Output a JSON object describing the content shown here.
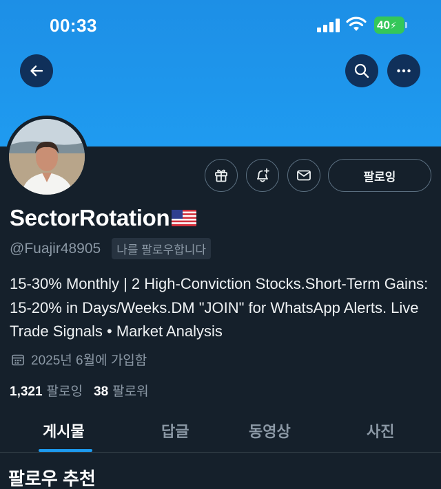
{
  "status_bar": {
    "time": "00:33",
    "battery": "40"
  },
  "profile": {
    "display_name": "SectorRotation",
    "handle": "@Fuajir48905",
    "follows_you": "나를 팔로우합니다",
    "bio": "15-30% Monthly | 2 High-Conviction Stocks.Short-Term Gains: 15-20% in Days/Weeks.DM \"JOIN\" for WhatsApp Alerts. Live Trade Signals • Market Analysis",
    "joined": "2025년 6월에 가입함",
    "following_count": "1,321",
    "following_label": "팔로잉",
    "followers_count": "38",
    "followers_label": "팔로워"
  },
  "actions": {
    "follow_button": "팔로잉"
  },
  "icons": [
    "back-arrow-icon",
    "search-icon",
    "more-icon",
    "gift-icon",
    "bell-plus-icon",
    "mail-icon",
    "calendar-icon",
    "us-flag-icon"
  ],
  "tabs": [
    {
      "label": "게시물",
      "active": true
    },
    {
      "label": "답글",
      "active": false
    },
    {
      "label": "동영상",
      "active": false
    },
    {
      "label": "사진",
      "active": false
    }
  ],
  "section": {
    "title": "팔로우 추천"
  },
  "colors": {
    "banner": "#1d9bf0",
    "background": "#15202b",
    "accent": "#1d9bf0",
    "muted_text": "#8b98a5"
  }
}
